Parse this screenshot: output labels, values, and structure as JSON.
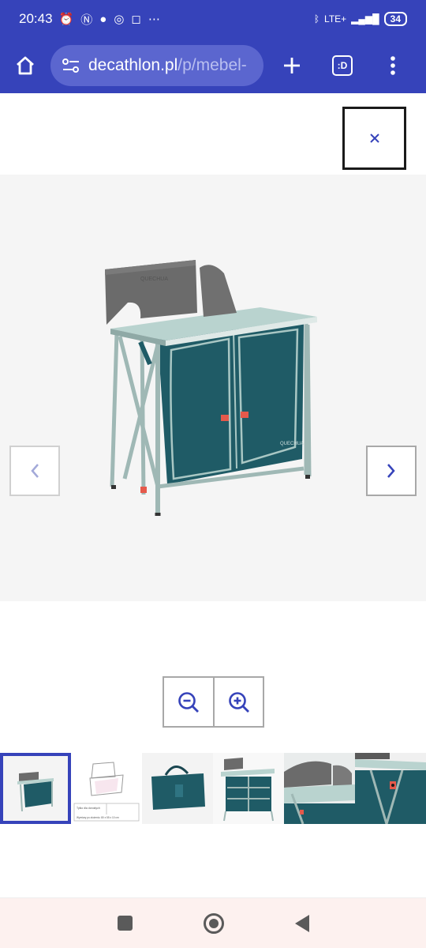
{
  "status_bar": {
    "time": "20:43",
    "network": "LTE+",
    "battery": "34"
  },
  "browser": {
    "url_domain": "decathlon.pl",
    "url_path": "/p/mebel-",
    "tab_label": ":D",
    "icons": [
      "home-icon",
      "site-settings-icon",
      "new-tab-icon",
      "tab-switcher-icon",
      "more-menu-icon"
    ]
  },
  "viewer": {
    "close_symbol": "×",
    "prev_symbol": "‹",
    "next_symbol": "›",
    "zoom_out_icon": "zoom-out-icon",
    "zoom_in_icon": "zoom-in-icon",
    "spec_small_text_1": "Tylko dla dorosłych",
    "spec_small_text_2": "Wymiary po złożeniu: 80 x 55 x 10 cm"
  },
  "thumbnails": [
    {
      "name": "camping-kitchen-front"
    },
    {
      "name": "dimensions-diagram"
    },
    {
      "name": "carry-bag"
    },
    {
      "name": "open-shelves"
    },
    {
      "name": "windscreen-closeup"
    },
    {
      "name": "side-detail"
    }
  ],
  "colors": {
    "brand": "#3643ba",
    "cabinet": "#1f5b66",
    "frame": "#9fb8b5"
  }
}
